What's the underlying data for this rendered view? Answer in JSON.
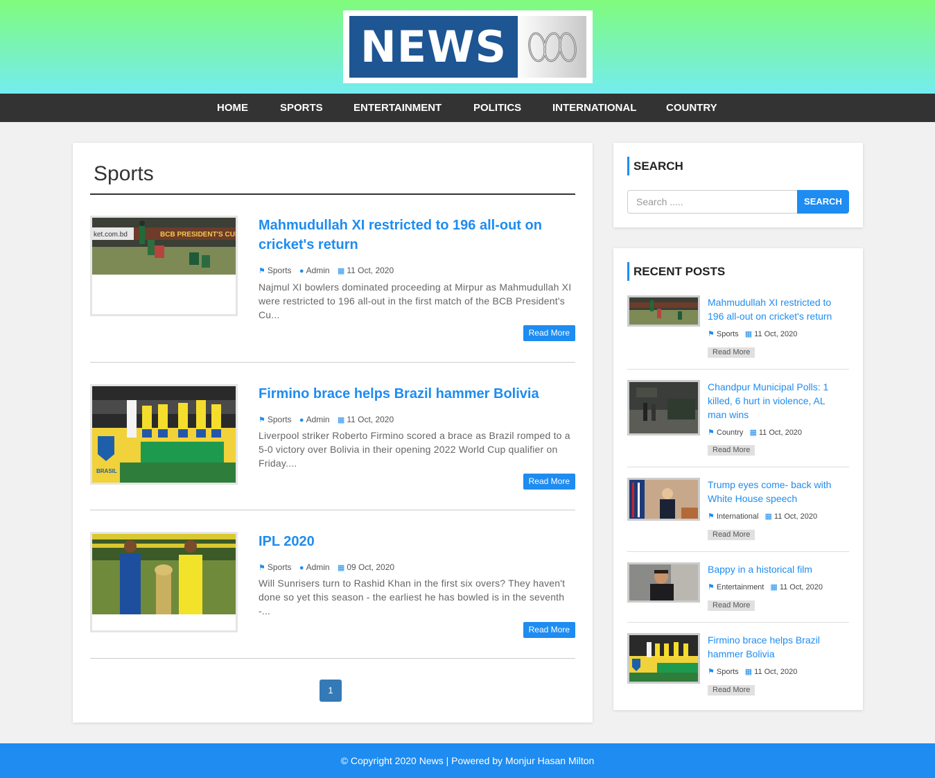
{
  "logo": {
    "text": "NEWS",
    "brand_icon": "abc-lissajous-logo"
  },
  "nav": {
    "items": [
      "HOME",
      "SPORTS",
      "ENTERTAINMENT",
      "POLITICS",
      "INTERNATIONAL",
      "COUNTRY"
    ]
  },
  "main": {
    "title": "Sports",
    "posts": [
      {
        "title": "Mahmudullah XI restricted to 196 all-out on cricket's return",
        "category": "Sports",
        "author": "Admin",
        "date": "11 Oct, 2020",
        "excerpt": "Najmul XI bowlers dominated proceeding at Mirpur as Mahmudullah XI were restricted to 196 all-out in the first match of the BCB President's Cu...",
        "read_more": "Read More",
        "thumb_banner": "BCB PRESIDENT'S CUP",
        "thumb_site": "ket.com.bd"
      },
      {
        "title": "Firmino brace helps Brazil hammer Bolivia",
        "category": "Sports",
        "author": "Admin",
        "date": "11 Oct, 2020",
        "excerpt": "Liverpool striker Roberto Firmino scored a brace as Brazil romped to a 5-0 victory over Bolivia in their opening 2022 World Cup qualifier on Friday....",
        "read_more": "Read More",
        "thumb_text": "BRASIL"
      },
      {
        "title": "IPL 2020",
        "category": "Sports",
        "author": "Admin",
        "date": "09 Oct, 2020",
        "excerpt": "Will Sunrisers turn to Rashid Khan in the first six overs? They haven't done so yet this season - the earliest he has bowled is in the seventh -...",
        "read_more": "Read More"
      }
    ],
    "pagination": {
      "current": "1"
    }
  },
  "sidebar": {
    "search": {
      "title": "SEARCH",
      "placeholder": "Search .....",
      "button": "SEARCH"
    },
    "recent": {
      "title": "RECENT POSTS",
      "items": [
        {
          "title": "Mahmudullah XI restricted to 196 all-out on cricket's return",
          "category": "Sports",
          "date": "11 Oct, 2020",
          "read_more": "Read More"
        },
        {
          "title": "Chandpur Municipal Polls: 1 killed, 6 hurt in violence, AL man wins",
          "category": "Country",
          "date": "11 Oct, 2020",
          "read_more": "Read More"
        },
        {
          "title": "Trump eyes come- back with White House speech",
          "category": "International",
          "date": "11 Oct, 2020",
          "read_more": "Read More"
        },
        {
          "title": "Bappy in a historical film",
          "category": "Entertainment",
          "date": "11 Oct, 2020",
          "read_more": "Read More"
        },
        {
          "title": "Firmino brace helps Brazil hammer Bolivia",
          "category": "Sports",
          "date": "11 Oct, 2020",
          "read_more": "Read More"
        }
      ]
    }
  },
  "footer": {
    "text": "© Copyright 2020 News | Powered by Monjur Hasan Milton"
  },
  "colors": {
    "accent": "#1e8cf0",
    "nav_bg": "#333333",
    "header_top": "#80fb7c",
    "header_bottom": "#74ecf0",
    "logo_blue": "#1e5593"
  }
}
